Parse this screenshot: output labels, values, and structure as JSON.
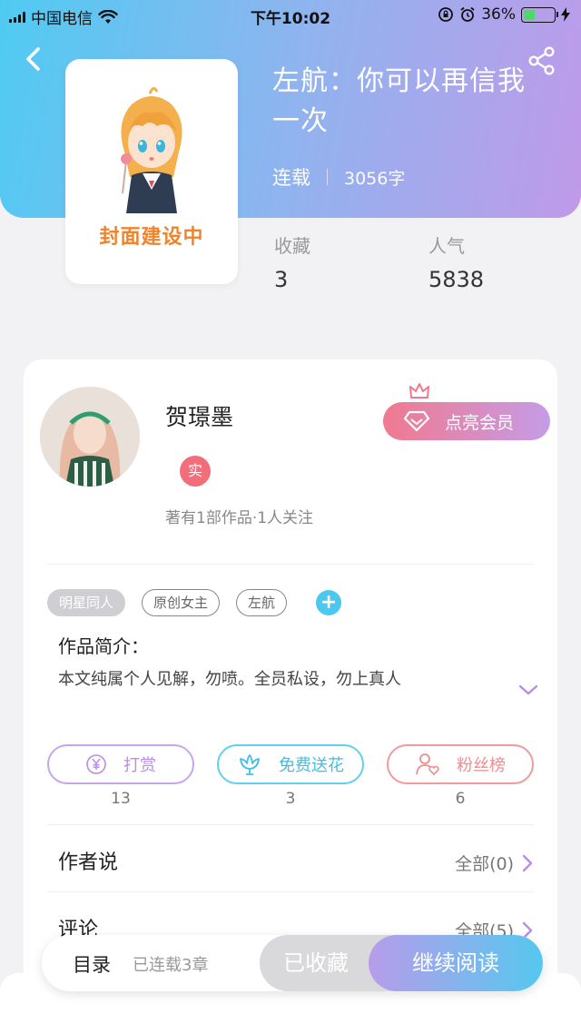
{
  "status_bar": {
    "carrier": "中国电信",
    "time": "下午10:02",
    "battery_percent": "36%",
    "battery_level": 0.36
  },
  "book": {
    "title": "左航：你可以再信我一次",
    "status": "连载",
    "word_count": "3056字",
    "cover_text": "封面建设中",
    "stats": [
      {
        "label": "收藏",
        "value": "3"
      },
      {
        "label": "人气",
        "value": "5838"
      }
    ]
  },
  "author": {
    "name": "贺璟墨",
    "verified_badge": "实",
    "stats": "著有1部作品·1人关注",
    "vip_label": "点亮会员"
  },
  "tags": [
    "明星同人",
    "原创女主",
    "左航"
  ],
  "tag_add": "+",
  "intro": {
    "title": "作品简介：",
    "text": "本文纯属个人见解，勿喷。全员私设，勿上真人"
  },
  "actions": [
    {
      "label": "打赏",
      "count": "13",
      "icon": "yen-coin-icon"
    },
    {
      "label": "免费送花",
      "count": "3",
      "icon": "flower-icon"
    },
    {
      "label": "粉丝榜",
      "count": "6",
      "icon": "fan-user-heart-icon"
    }
  ],
  "sections": [
    {
      "title": "作者说",
      "link": "全部(0)"
    },
    {
      "title": "评论",
      "link": "全部(5)"
    }
  ],
  "bottom_bar": {
    "catalog": "目录",
    "chapters": "已连载3章",
    "collected": "已收藏",
    "read": "继续阅读"
  },
  "colors": {
    "header_start": "#4fcbf2",
    "header_end": "#bf9ae9",
    "cover_text": "#f0842c",
    "accent_blue": "#4cc8ef",
    "accent_pink": "#f26e7a"
  }
}
